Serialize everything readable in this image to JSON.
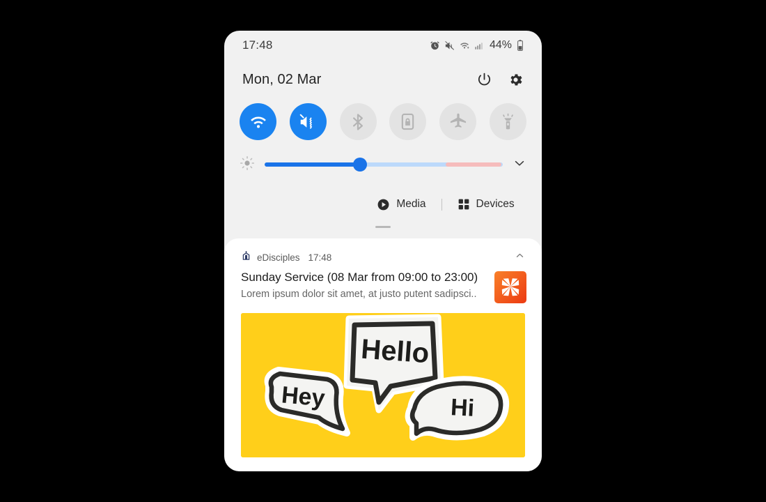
{
  "statusbar": {
    "time": "17:48",
    "battery_percent": "44%",
    "icons": [
      "alarm-icon",
      "vibrate-icon",
      "wifi-icon",
      "signal-icon",
      "battery-icon"
    ]
  },
  "quick_panel": {
    "date": "Mon, 02 Mar",
    "power_icon": "power-icon",
    "settings_icon": "gear-icon",
    "toggles": [
      {
        "name": "wifi",
        "label": "Wi-Fi",
        "icon": "wifi-icon",
        "state": "on"
      },
      {
        "name": "sound",
        "label": "Vibrate",
        "icon": "vibrate-icon",
        "state": "on"
      },
      {
        "name": "bluetooth",
        "label": "Bluetooth",
        "icon": "bluetooth-icon",
        "state": "off"
      },
      {
        "name": "secure",
        "label": "Secure Folder",
        "icon": "lock-card-icon",
        "state": "off"
      },
      {
        "name": "airplane",
        "label": "Airplane mode",
        "icon": "airplane-icon",
        "state": "off"
      },
      {
        "name": "flashlight",
        "label": "Flashlight",
        "icon": "flashlight-icon",
        "state": "off"
      }
    ],
    "brightness": {
      "icon": "brightness-icon",
      "value_percent": 40,
      "expand_icon": "chevron-down-icon"
    },
    "media_label": "Media",
    "media_icon": "play-circle-icon",
    "devices_label": "Devices",
    "devices_icon": "grid-dots-icon"
  },
  "notification": {
    "app_icon": "church-icon",
    "app_name": "eDisciples",
    "time": "17:48",
    "collapse_icon": "chevron-up-icon",
    "title": "Sunday Service (08 Mar from 09:00 to 23:00)",
    "subtitle": "Lorem ipsum dolor sit amet, at justo putent sadipsci..",
    "thumb_icon": "pinwheel-logo-icon",
    "picture": {
      "name": "speech-bubbles-photo",
      "background_color": "#ffcf1a",
      "bubbles": [
        {
          "text": "Hey",
          "shape": "rounded-rect"
        },
        {
          "text": "Hello",
          "shape": "angular-rect"
        },
        {
          "text": "Hi",
          "shape": "oval"
        }
      ]
    }
  },
  "colors": {
    "accent_blue": "#1a83f0",
    "slider_blue": "#1a73e8",
    "slider_track": "#bcd9fb",
    "slider_pink": "#f6bcbc",
    "toggle_off": "#e3e3e3",
    "panel_bg": "#f1f1f1",
    "card_bg": "#ffffff",
    "photo_yellow": "#ffcf1a",
    "thumb_orange": "#f15a22"
  }
}
